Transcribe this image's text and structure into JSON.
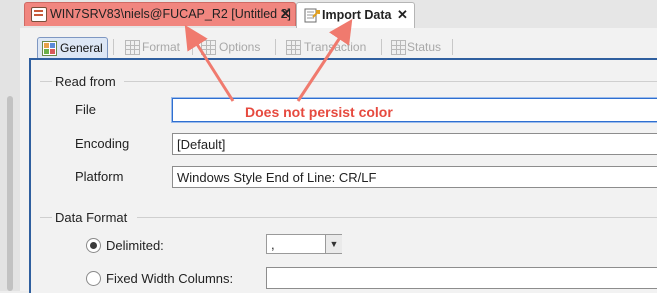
{
  "editor_tabs": [
    {
      "label": "WIN7SRV83\\niels@FUCAP_R2 [Untitled 2]",
      "close": "✕",
      "color": "#f1867f"
    },
    {
      "label": "Import Data",
      "close": "✕"
    }
  ],
  "sub_tabs": [
    {
      "label": "General",
      "active": true
    },
    {
      "label": "Format",
      "active": false
    },
    {
      "label": "Options",
      "active": false
    },
    {
      "label": "Transaction",
      "active": false
    },
    {
      "label": "Status",
      "active": false
    }
  ],
  "read_from": {
    "section_title": "Read from",
    "file_label": "File",
    "file_value": "",
    "encoding_label": "Encoding",
    "encoding_value": "[Default]",
    "platform_label": "Platform",
    "platform_value": "Windows Style End of Line: CR/LF"
  },
  "data_format": {
    "section_title": "Data Format",
    "delimited_label": "Delimited:",
    "delimited_selected": true,
    "delimiter_value": ",",
    "fixed_width_label": "Fixed Width Columns:",
    "fixed_width_selected": false,
    "fixed_width_value": ""
  },
  "annotation": {
    "text": "Does not persist color",
    "color": "#e64a3f"
  }
}
